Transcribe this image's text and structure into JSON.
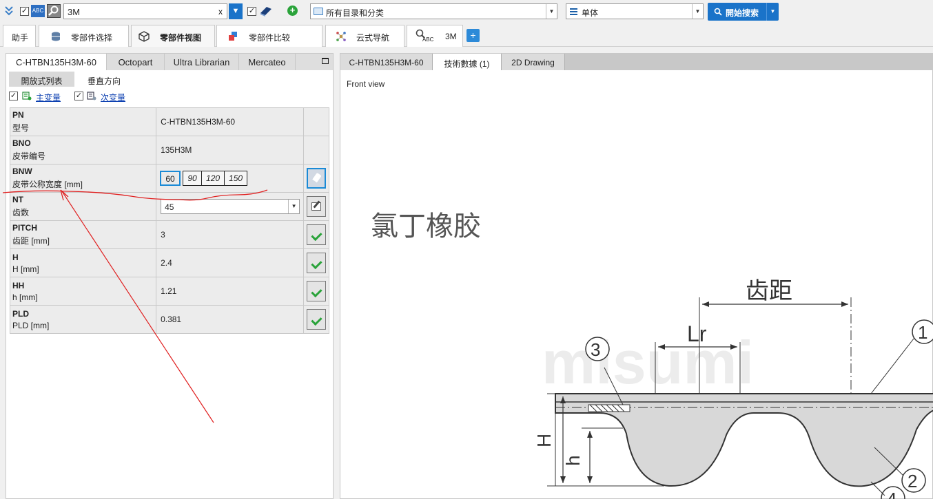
{
  "toolbar": {
    "search_value": "3M",
    "clear_label": "x",
    "abc_label": "ABC",
    "catalog_value": "所有目录和分类",
    "unit_value": "单体",
    "start_search_label": "開始搜索"
  },
  "main_tabs": [
    {
      "label": "助手"
    },
    {
      "label": "零部件选择"
    },
    {
      "label": "零部件视图"
    },
    {
      "label": "零部件比较"
    },
    {
      "label": "云式导航"
    },
    {
      "label": "3M",
      "icon_text": "ABC"
    }
  ],
  "add_tab_label": "+",
  "left_panel": {
    "source_tabs": [
      "C-HTBN135H3M-60",
      "Octopart",
      "Ultra Librarian",
      "Mercateo"
    ],
    "view_tabs": [
      "開放式列表",
      "垂直方向"
    ],
    "primary_variable": "主变量",
    "secondary_variable": "次变量",
    "params": [
      {
        "code": "PN",
        "desc": "型号",
        "value": "C-HTBN135H3M-60"
      },
      {
        "code": "BNO",
        "desc": "皮带编号",
        "value": "135H3M"
      },
      {
        "code": "BNW",
        "desc": "皮带公称宽度 [mm]",
        "options": [
          "60",
          "90",
          "120",
          "150"
        ],
        "selected": "60"
      },
      {
        "code": "NT",
        "desc": "齿数",
        "value": "45"
      },
      {
        "code": "PITCH",
        "desc": "齿距 [mm]",
        "value": "3"
      },
      {
        "code": "H",
        "desc": "H [mm]",
        "value": "2.4"
      },
      {
        "code": "HH",
        "desc": "h [mm]",
        "value": "1.21"
      },
      {
        "code": "PLD",
        "desc": "PLD [mm]",
        "value": "0.381"
      }
    ]
  },
  "right_panel": {
    "tabs": [
      "C-HTBN135H3M-60",
      "技術數據 (1)",
      "2D Drawing"
    ],
    "view_label": "Front view",
    "drawing": {
      "material": "氯丁橡胶",
      "pitch_label": "齿距",
      "lr_label": "Lr",
      "watermark": "misumi",
      "H_label": "H",
      "h_label": "h",
      "callouts": [
        "1",
        "2",
        "3",
        "4"
      ]
    }
  },
  "colors": {
    "accent": "#1a73c9",
    "annotation": "#e02020",
    "check_green": "#2aa33a"
  }
}
